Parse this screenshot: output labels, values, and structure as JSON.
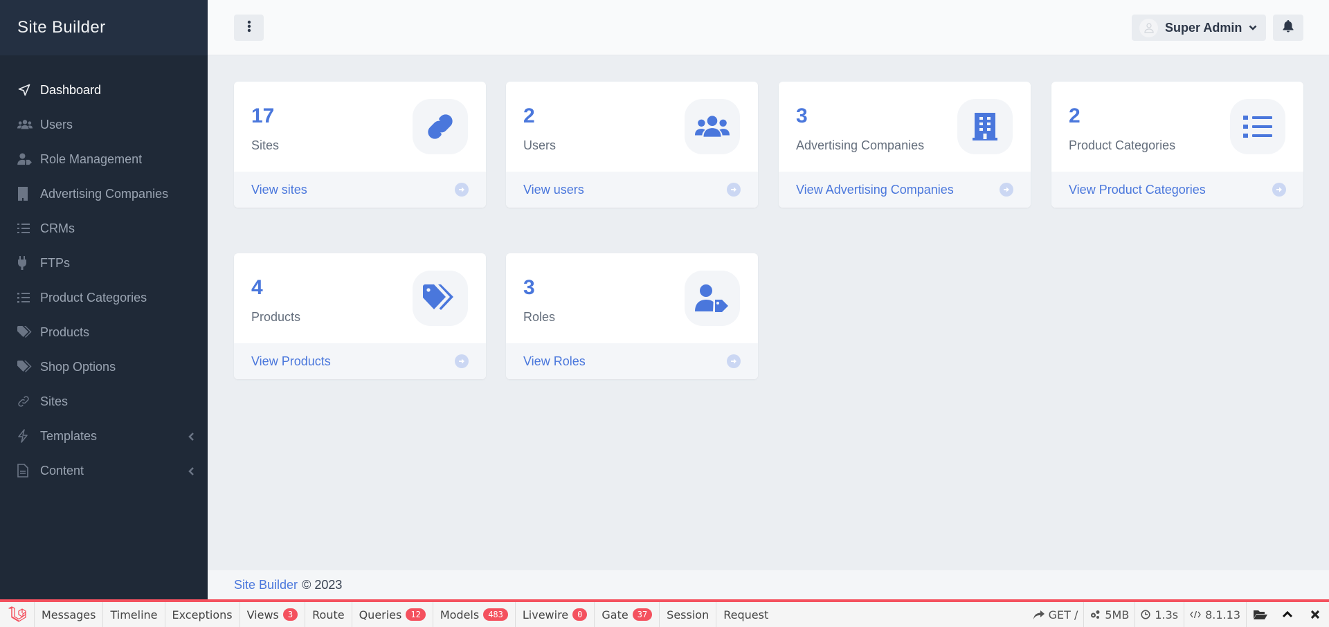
{
  "app": {
    "title": "Site Builder"
  },
  "colors": {
    "accent": "#4a77dc",
    "sidebar_bg": "#1f2937",
    "debugbar_accent": "#f4515e"
  },
  "sidebar": {
    "items": [
      {
        "label": "Dashboard",
        "icon": "paper-plane-icon",
        "active": true
      },
      {
        "label": "Users",
        "icon": "users-icon"
      },
      {
        "label": "Role Management",
        "icon": "user-tag-icon"
      },
      {
        "label": "Advertising Companies",
        "icon": "building-icon"
      },
      {
        "label": "CRMs",
        "icon": "list-check-icon"
      },
      {
        "label": "FTPs",
        "icon": "plug-icon"
      },
      {
        "label": "Product Categories",
        "icon": "list-icon"
      },
      {
        "label": "Products",
        "icon": "tags-icon"
      },
      {
        "label": "Shop Options",
        "icon": "tags-icon"
      },
      {
        "label": "Sites",
        "icon": "link-icon"
      },
      {
        "label": "Templates",
        "icon": "bolt-icon",
        "has_submenu": true
      },
      {
        "label": "Content",
        "icon": "file-icon",
        "has_submenu": true
      }
    ]
  },
  "header": {
    "menu_icon": "ellipsis-vertical-icon",
    "user": {
      "name": "Super Admin"
    },
    "notifications_icon": "bell-icon"
  },
  "cards": [
    {
      "count": "17",
      "label": "Sites",
      "link": "View sites",
      "icon": "link-icon"
    },
    {
      "count": "2",
      "label": "Users",
      "link": "View users",
      "icon": "users-icon"
    },
    {
      "count": "3",
      "label": "Advertising Companies",
      "link": "View Advertising Companies",
      "icon": "building-icon"
    },
    {
      "count": "2",
      "label": "Product Categories",
      "link": "View Product Categories",
      "icon": "list-icon"
    },
    {
      "count": "4",
      "label": "Products",
      "link": "View Products",
      "icon": "tags-icon"
    },
    {
      "count": "3",
      "label": "Roles",
      "link": "View Roles",
      "icon": "user-tag-icon"
    }
  ],
  "footer": {
    "brand": "Site Builder",
    "copyright": "© 2023"
  },
  "debugbar": {
    "tabs": [
      {
        "label": "Messages"
      },
      {
        "label": "Timeline"
      },
      {
        "label": "Exceptions"
      },
      {
        "label": "Views",
        "badge": "3"
      },
      {
        "label": "Route"
      },
      {
        "label": "Queries",
        "badge": "12"
      },
      {
        "label": "Models",
        "badge": "483"
      },
      {
        "label": "Livewire",
        "badge": "0"
      },
      {
        "label": "Gate",
        "badge": "37"
      },
      {
        "label": "Session"
      },
      {
        "label": "Request"
      }
    ],
    "stats": {
      "request": "GET /",
      "memory": "5MB",
      "time": "1.3s",
      "php_version": "8.1.13"
    }
  }
}
